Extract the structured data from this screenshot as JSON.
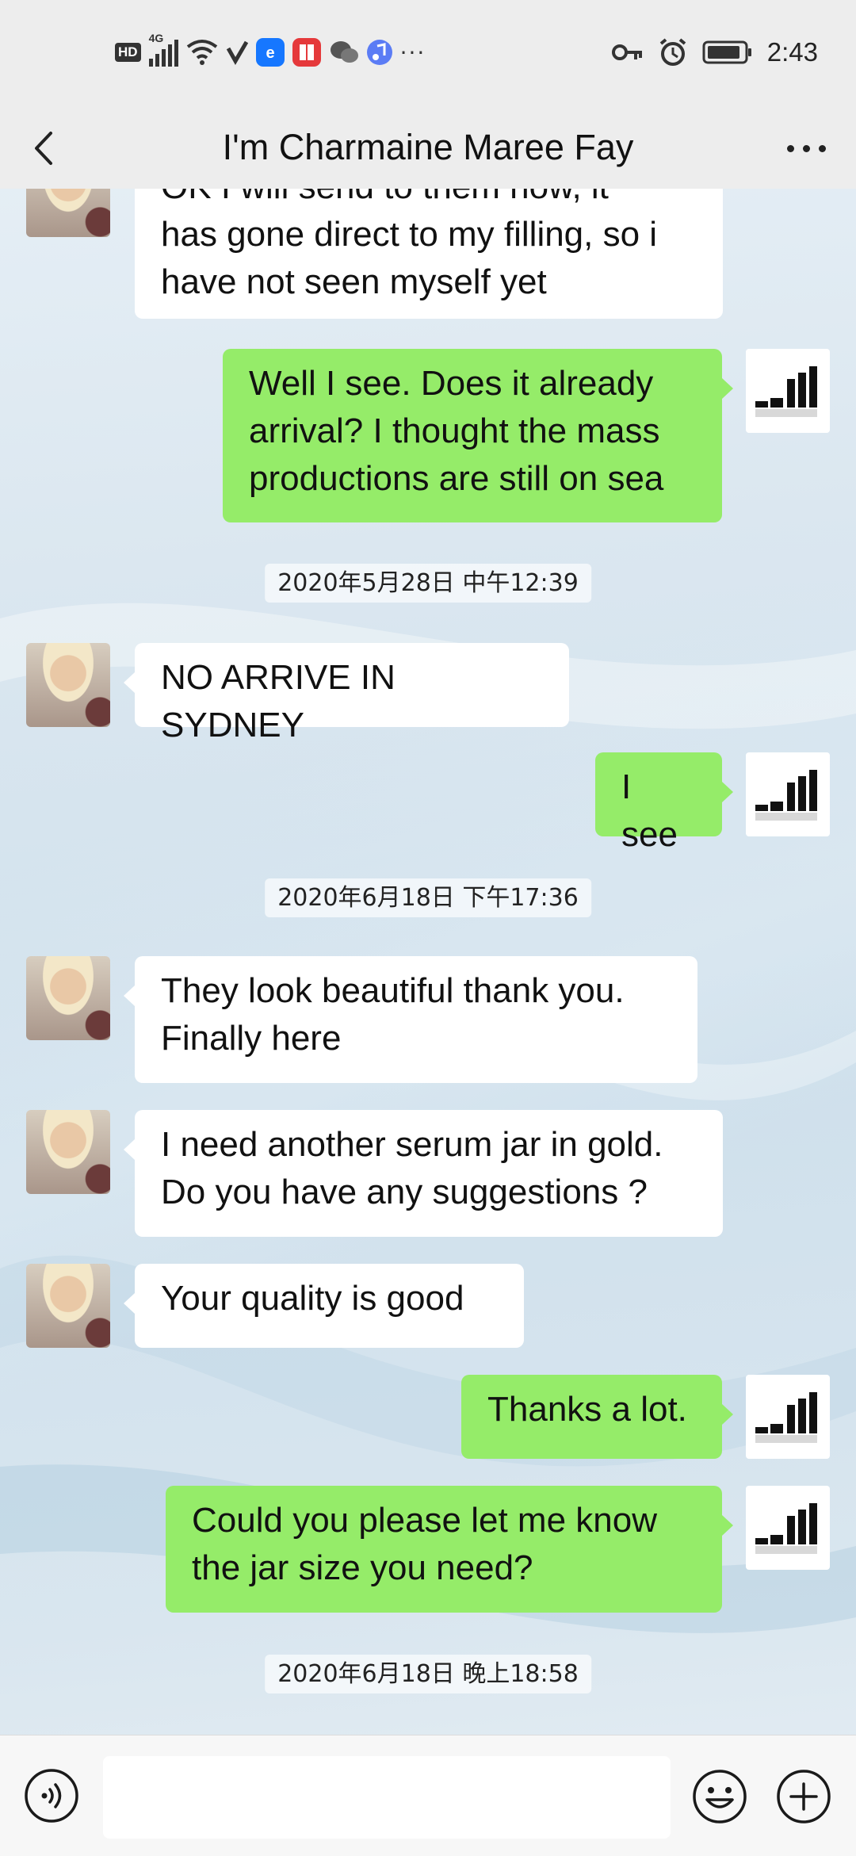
{
  "status_bar": {
    "left_badges": [
      "HD",
      "4G"
    ],
    "time": "2:43",
    "icons": [
      "signal-icon",
      "wifi-icon",
      "check-icon",
      "alipay-icon",
      "book-icon",
      "wechat-icon",
      "music-icon",
      "more-dots-icon",
      "key-icon",
      "alarm-icon",
      "battery-icon"
    ]
  },
  "header": {
    "title": "I'm Charmaine Maree Fay",
    "back_icon": "chevron-left-icon",
    "more_icon": "more-horizontal-icon"
  },
  "messages": [
    {
      "from": "them",
      "text": "OK I will send to them now, it\nhas gone direct to my filling, so i\nhave not seen myself yet"
    },
    {
      "from": "me",
      "text": "Well I see. Does it already\narrival? I thought the mass\nproductions are still on sea"
    },
    {
      "type": "timestamp",
      "text": "2020年5月28日 中午12:39"
    },
    {
      "from": "them",
      "text": "NO ARRIVE IN SYDNEY"
    },
    {
      "from": "me",
      "text": "I see"
    },
    {
      "type": "timestamp",
      "text": "2020年6月18日 下午17:36"
    },
    {
      "from": "them",
      "text": "They look beautiful thank you.\nFinally here"
    },
    {
      "from": "them",
      "text": "I need another serum jar in gold.\nDo you have any suggestions ?"
    },
    {
      "from": "them",
      "text": "Your quality is good"
    },
    {
      "from": "me",
      "text": "Thanks a lot."
    },
    {
      "from": "me",
      "text": "Could you please let me know\nthe jar size you need?"
    },
    {
      "type": "timestamp",
      "text": "2020年6月18日 晚上18:58"
    }
  ],
  "input_bar": {
    "placeholder": "",
    "icons": [
      "voice-icon",
      "emoji-icon",
      "plus-icon"
    ]
  },
  "colors": {
    "my_bubble": "#95ec69",
    "their_bubble": "#ffffff",
    "header_bg": "#ededed"
  }
}
